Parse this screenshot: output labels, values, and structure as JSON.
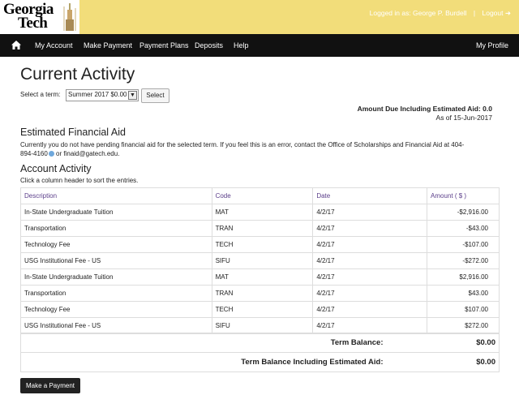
{
  "header": {
    "logo_line1": "Georgia",
    "logo_line2": "Tech",
    "logged_in_text": "Logged in as: George P. Burdell",
    "logout_label": "Logout"
  },
  "nav": {
    "items": [
      {
        "label": "My Account"
      },
      {
        "label": "Make Payment"
      },
      {
        "label": "Payment Plans"
      },
      {
        "label": "Deposits"
      },
      {
        "label": "Help"
      }
    ],
    "profile_label": "My Profile"
  },
  "page": {
    "title": "Current Activity",
    "term_label": "Select a term:",
    "term_selected": "Summer 2017 $0.00",
    "select_button": "Select",
    "amount_due": "Amount Due Including Estimated Aid: 0.0",
    "as_of": "As of 15-Jun-2017"
  },
  "aid": {
    "heading": "Estimated Financial Aid",
    "text1": "Currently you do not have pending financial aid for the selected term. If you feel this is an error, contact the Office of Scholarships and Financial Aid at",
    "phone": "404-894-4160",
    "text2": " or finaid@gatech.edu."
  },
  "activity": {
    "heading": "Account Activity",
    "hint": "Click a column header to sort the entries.",
    "columns": [
      "Description",
      "Code",
      "Date",
      "Amount ( $ )"
    ],
    "rows": [
      {
        "description": "In-State Undergraduate Tuition",
        "code": "MAT",
        "date": "4/2/17",
        "amount": "-$2,916.00"
      },
      {
        "description": "Transportation",
        "code": "TRAN",
        "date": "4/2/17",
        "amount": "-$43.00"
      },
      {
        "description": "Technology Fee",
        "code": "TECH",
        "date": "4/2/17",
        "amount": "-$107.00"
      },
      {
        "description": "USG Institutional Fee - US",
        "code": "SIFU",
        "date": "4/2/17",
        "amount": "-$272.00"
      },
      {
        "description": "In-State Undergraduate Tuition",
        "code": "MAT",
        "date": "4/2/17",
        "amount": "$2,916.00"
      },
      {
        "description": "Transportation",
        "code": "TRAN",
        "date": "4/2/17",
        "amount": "$43.00"
      },
      {
        "description": "Technology Fee",
        "code": "TECH",
        "date": "4/2/17",
        "amount": "$107.00"
      },
      {
        "description": "USG Institutional Fee - US",
        "code": "SIFU",
        "date": "4/2/17",
        "amount": "$272.00"
      }
    ],
    "term_balance_label": "Term Balance:",
    "term_balance": "$0.00",
    "term_balance_aid_label": "Term Balance Including Estimated Aid:",
    "term_balance_aid": "$0.00"
  },
  "make_payment_button": "Make a Payment",
  "colors": {
    "banner": "#f2dd7a",
    "nav": "#111111",
    "header_link": "#5b3e8a"
  }
}
